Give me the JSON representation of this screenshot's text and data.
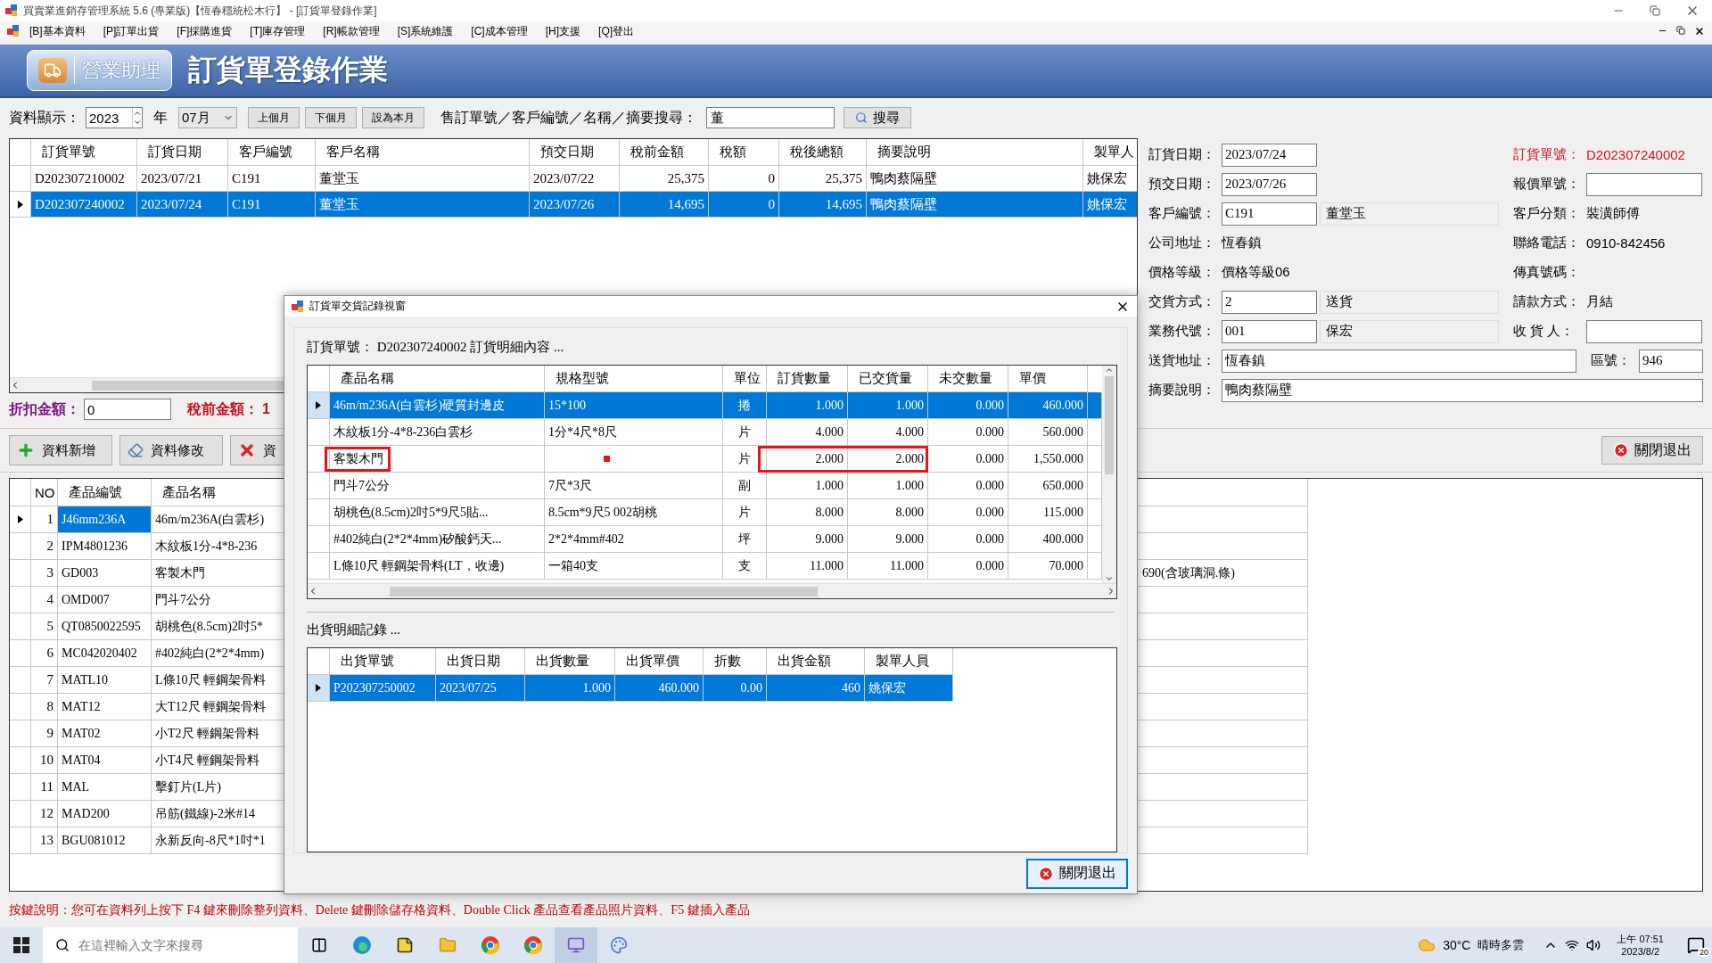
{
  "window": {
    "title": "買賣業進銷存管理系統 5.6 (專業版)【恆春穩統松木行】 - [訂貨單登錄作業]"
  },
  "menu": [
    "[B]基本資料",
    "[P]訂單出貨",
    "[F]採購進貨",
    "[T]庫存管理",
    "[R]帳款管理",
    "[S]系統維護",
    "[C]成本管理",
    "[H]支援",
    "[Q]登出"
  ],
  "banner": {
    "badge": "營業助理",
    "title": "訂貨單登錄作業"
  },
  "filter": {
    "label": "資料顯示：",
    "year": "2023",
    "year_unit": "年",
    "month": "07月",
    "buttons": [
      "上個月",
      "下個月",
      "設為本月"
    ],
    "search_label": "售訂單號／客戶編號／名稱／摘要搜尋：",
    "search_value": "董",
    "search_button": "搜尋"
  },
  "orders": {
    "columns": [
      "訂貨單號",
      "訂貨日期",
      "客戶編號",
      "客戶名稱",
      "預交日期",
      "稅前金額",
      "稅額",
      "稅後總額",
      "摘要說明",
      "製單人"
    ],
    "rows": [
      {
        "selected": false,
        "cells": [
          "D202307210002",
          "2023/07/21",
          "C191",
          "董堂玉",
          "2023/07/22",
          "25,375",
          "0",
          "25,375",
          "鴨肉蔡隔壁",
          "姚保宏"
        ]
      },
      {
        "selected": true,
        "cells": [
          "D202307240002",
          "2023/07/24",
          "C191",
          "董堂玉",
          "2023/07/26",
          "14,695",
          "0",
          "14,695",
          "鴨肉蔡隔壁",
          "姚保宏"
        ]
      }
    ]
  },
  "form": {
    "rows": [
      {
        "left": {
          "kind": "field",
          "label": "訂貨日期：",
          "value": "2023/07/24"
        },
        "right": {
          "kind": "alert",
          "label": "訂貨單號：",
          "value": "D202307240002"
        }
      },
      {
        "left": {
          "kind": "field",
          "label": "預交日期：",
          "value": "2023/07/26"
        },
        "right": {
          "kind": "field",
          "label": "報價單號："
        }
      },
      {
        "left": {
          "kind": "pair",
          "label": "客戶編號：",
          "value": "C191",
          "name": "董堂玉"
        },
        "right": {
          "kind": "text",
          "label": "客戶分類：",
          "value": "裝潢師傅"
        }
      },
      {
        "left": {
          "kind": "text",
          "label": "公司地址：",
          "value": "恆春鎮"
        },
        "right": {
          "kind": "text",
          "label": "聯絡電話：",
          "value": "0910-842456"
        }
      },
      {
        "left": {
          "kind": "text",
          "label": "價格等級：",
          "value": "價格等級06"
        },
        "right": {
          "kind": "text",
          "label": "傳真號碼："
        }
      },
      {
        "left": {
          "kind": "pair",
          "label": "交貨方式：",
          "value": "2",
          "name": "送貨"
        },
        "right": {
          "kind": "text",
          "label": "請款方式：",
          "value": "月結"
        }
      },
      {
        "left": {
          "kind": "pair",
          "label": "業務代號：",
          "value": "001",
          "name": "保宏"
        },
        "right": {
          "kind": "field",
          "label": "收 貨 人："
        }
      },
      {
        "left": {
          "kind": "wide",
          "label": "送貨地址：",
          "value": "恆春鎮"
        },
        "right": {
          "kind": "short",
          "label": "區號：",
          "value": "946"
        }
      },
      {
        "left": {
          "kind": "full",
          "label": "摘要說明：",
          "value": "鴨肉蔡隔壁"
        }
      }
    ]
  },
  "discount": {
    "label": "折扣金額：",
    "value": "0",
    "subtotal_label": "稅前金額：",
    "subtotal_value": "1"
  },
  "actions": {
    "buttons": [
      {
        "kind": "add",
        "label": "資料新增"
      },
      {
        "kind": "edit",
        "label": "資料修改"
      },
      {
        "kind": "delete",
        "label": "資"
      }
    ],
    "close": "關閉退出"
  },
  "details": {
    "columns": [
      "NO",
      "產品編號",
      "產品名稱"
    ],
    "rows": [
      {
        "no": "1",
        "code": "J46mm236A",
        "name": "46m/m236A(白雲杉)",
        "selected": true
      },
      {
        "no": "2",
        "code": "IPM4801236",
        "name": "木紋板1分-4*8-236",
        "selected": false
      },
      {
        "no": "3",
        "code": "GD003",
        "name": "客製木門",
        "column_5": "690(含玻璃洞.條)",
        "selected": false
      },
      {
        "no": "4",
        "code": "OMD007",
        "name": "門斗7公分",
        "selected": false
      },
      {
        "no": "5",
        "code": "QT0850022595",
        "name": "胡桃色(8.5cm)2吋5*",
        "selected": false
      },
      {
        "no": "6",
        "code": "MC042020402",
        "name": "#402純白(2*2*4mm)",
        "selected": false
      },
      {
        "no": "7",
        "code": "MATL10",
        "name": "L條10尺 輕鋼架骨料",
        "selected": false
      },
      {
        "no": "8",
        "code": "MAT12",
        "name": "大T12尺 輕鋼架骨料",
        "selected": false
      },
      {
        "no": "9",
        "code": "MAT02",
        "name": "小T2尺 輕鋼架骨料",
        "selected": false
      },
      {
        "no": "10",
        "code": "MAT04",
        "name": "小T4尺 輕鋼架骨料",
        "selected": false
      },
      {
        "no": "11",
        "code": "MAL",
        "name": "擊釘片(L片)",
        "selected": false
      },
      {
        "no": "12",
        "code": "MAD200",
        "name": "吊筋(鐵線)-2米#14",
        "selected": false
      },
      {
        "no": "13",
        "code": "BGU081012",
        "name": "永新反向-8尺*1吋*1",
        "selected": false
      }
    ]
  },
  "status": "按鍵說明：您可在資料列上按下 F4 鍵來刪除整列資料、Delete 鍵刪除儲存格資料、Double Click 產品查看產品照片資料、F5 鍵插入產品",
  "dialog": {
    "title": "訂貨單交貨記錄視窗",
    "heading": "訂貨單號： D202307240002  訂貨明細內容 ...",
    "items": {
      "columns": [
        "產品名稱",
        "規格型號",
        "單位",
        "訂貨數量",
        "已交貨量",
        "未交數量",
        "單價"
      ],
      "rows": [
        {
          "selected": true,
          "name": "46m/m236A(白雲杉)硬質封邊皮",
          "spec": "15*100",
          "unit": "捲",
          "ordered": "1.000",
          "delivered": "1.000",
          "open": "0.000",
          "price": "460.000",
          "mark_name": false,
          "mark_qty": false,
          "spec_dot": false
        },
        {
          "selected": false,
          "name": "木紋板1分-4*8-236白雲杉",
          "spec": "1分*4尺*8尺",
          "unit": "片",
          "ordered": "4.000",
          "delivered": "4.000",
          "open": "0.000",
          "price": "560.000",
          "mark_name": false,
          "mark_qty": false,
          "spec_dot": false
        },
        {
          "selected": false,
          "name": "客製木門",
          "unit": "片",
          "ordered": "2.000",
          "delivered": "2.000",
          "open": "0.000",
          "price": "1,550.000",
          "mark_name": true,
          "mark_qty": true,
          "spec_dot": true
        },
        {
          "selected": false,
          "name": "門斗7公分",
          "spec": "7尺*3尺",
          "unit": "副",
          "ordered": "1.000",
          "delivered": "1.000",
          "open": "0.000",
          "price": "650.000",
          "mark_name": false,
          "mark_qty": false,
          "spec_dot": false
        },
        {
          "selected": false,
          "name": "胡桃色(8.5cm)2吋5*9尺5貼...",
          "spec": "8.5cm*9尺5  002胡桃",
          "unit": "片",
          "ordered": "8.000",
          "delivered": "8.000",
          "open": "0.000",
          "price": "115.000",
          "mark_name": false,
          "mark_qty": false,
          "spec_dot": false
        },
        {
          "selected": false,
          "name": "#402純白(2*2*4mm)矽酸鈣天...",
          "spec": "2*2*4mm#402",
          "unit": "坪",
          "ordered": "9.000",
          "delivered": "9.000",
          "open": "0.000",
          "price": "400.000",
          "mark_name": false,
          "mark_qty": false,
          "spec_dot": false
        },
        {
          "selected": false,
          "name": "L條10尺 輕鋼架骨料(LT，收邊)",
          "spec": "一箱40支",
          "unit": "支",
          "ordered": "11.000",
          "delivered": "11.000",
          "open": "0.000",
          "price": "70.000",
          "mark_name": false,
          "mark_qty": false,
          "spec_dot": false
        }
      ]
    },
    "shipments": {
      "label": "出貨明細記錄 ...",
      "columns": [
        "出貨單號",
        "出貨日期",
        "出貨數量",
        "出貨單價",
        "折數",
        "出貨金額",
        "製單人員"
      ],
      "rows": [
        {
          "selected": true,
          "cells": [
            "P202307250002",
            "2023/07/25",
            "1.000",
            "460.000",
            "0.00",
            "460",
            "姚保宏"
          ]
        }
      ]
    },
    "close": "關閉退出"
  },
  "taskbar": {
    "search_placeholder": "在這裡輸入文字來搜尋",
    "temperature": "30°C",
    "weather": "晴時多雲",
    "time": "上午 07:51",
    "date": "2023/8/2",
    "notifications": "20"
  }
}
